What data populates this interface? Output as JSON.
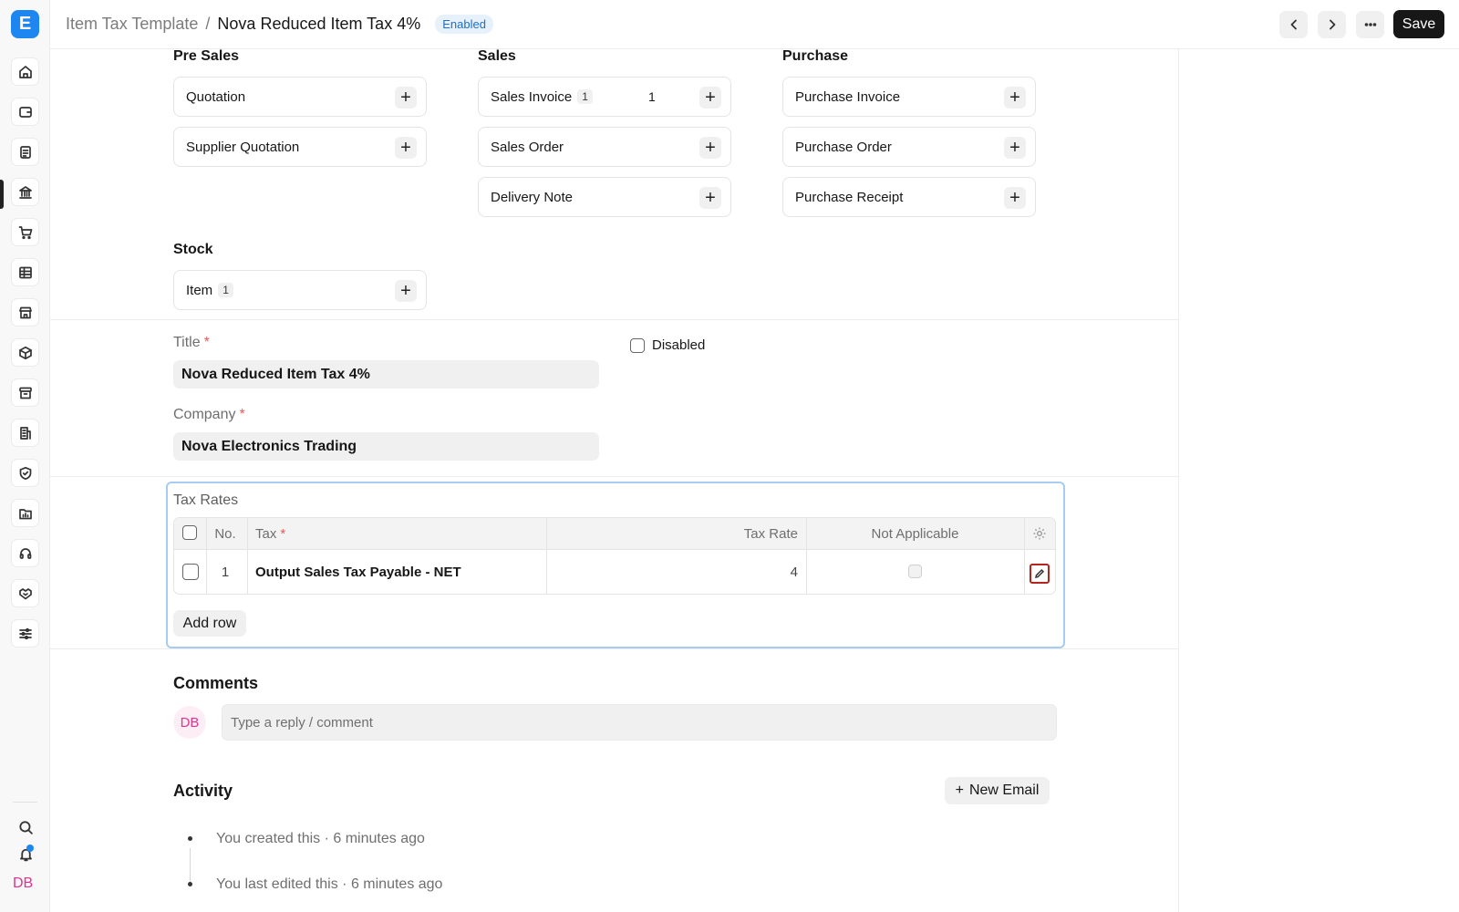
{
  "app": {
    "logo_letter": "E",
    "brand_color": "#1e86f0"
  },
  "sidebar": {
    "icons": [
      "home-icon",
      "wallet-icon",
      "document-icon",
      "bank-icon",
      "cart-icon",
      "table-icon",
      "store-icon",
      "box-icon",
      "archive-icon",
      "building-icon",
      "shield-icon",
      "folder-chart-icon",
      "headset-icon",
      "handshake-icon",
      "sliders-icon"
    ],
    "active_icon": "bank-icon",
    "bottom_icons": [
      "search-icon",
      "bell-icon"
    ],
    "avatar_initials": "DB"
  },
  "header": {
    "breadcrumb_parent": "Item Tax Template",
    "separator": "/",
    "title": "Nova Reduced Item Tax 4%",
    "status_badge": "Enabled",
    "save_label": "Save"
  },
  "connections": {
    "groups": [
      {
        "heading": "Pre Sales",
        "items": [
          {
            "label": "Quotation"
          },
          {
            "label": "Supplier Quotation"
          }
        ]
      },
      {
        "heading": "Sales",
        "items": [
          {
            "label": "Sales Invoice",
            "count": "1",
            "value": "1"
          },
          {
            "label": "Sales Order"
          },
          {
            "label": "Delivery Note"
          }
        ]
      },
      {
        "heading": "Purchase",
        "items": [
          {
            "label": "Purchase Invoice"
          },
          {
            "label": "Purchase Order"
          },
          {
            "label": "Purchase Receipt"
          }
        ]
      },
      {
        "heading": "Stock",
        "items": [
          {
            "label": "Item",
            "count": "1"
          }
        ]
      }
    ],
    "plus_glyph": "+"
  },
  "form": {
    "title_label": "Title",
    "title_value": "Nova Reduced Item Tax 4%",
    "company_label": "Company",
    "company_value": "Nova Electronics Trading",
    "disabled_label": "Disabled",
    "required_mark": "*"
  },
  "tax_rates": {
    "section_label": "Tax Rates",
    "columns": {
      "no": "No.",
      "tax": "Tax",
      "rate": "Tax Rate",
      "na": "Not Applicable"
    },
    "rows": [
      {
        "no": "1",
        "tax": "Output Sales Tax Payable - NET",
        "rate": "4"
      }
    ],
    "add_row_label": "Add row"
  },
  "comments": {
    "heading": "Comments",
    "avatar": "DB",
    "placeholder": "Type a reply / comment"
  },
  "activity": {
    "heading": "Activity",
    "new_email_label": "New Email",
    "new_email_glyph": "+",
    "items": [
      "You created this · 6 minutes ago",
      "You last edited this · 6 minutes ago"
    ]
  }
}
